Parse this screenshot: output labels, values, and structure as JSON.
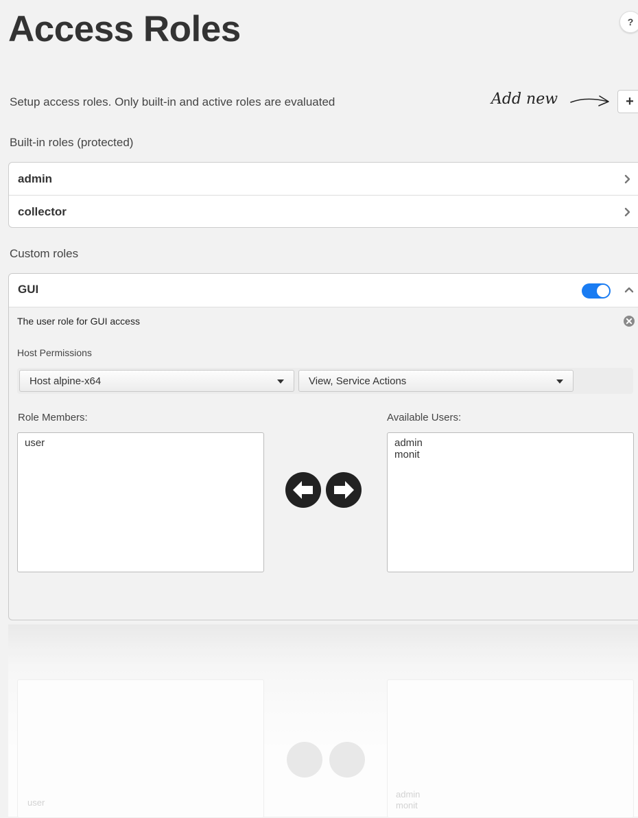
{
  "page": {
    "title": "Access Roles",
    "help_label": "?",
    "subtitle": "Setup access roles. Only built-in and active roles are evaluated",
    "add_new_hint": "Add new",
    "add_button_label": "+"
  },
  "builtin": {
    "label": "Built-in roles (protected)",
    "roles": [
      {
        "name": "admin"
      },
      {
        "name": "collector"
      }
    ]
  },
  "custom": {
    "label": "Custom roles",
    "role": {
      "name": "GUI",
      "active": true,
      "description": "The user role for GUI access",
      "host_permissions_label": "Host Permissions",
      "host_select": "Host alpine-x64",
      "permission_select": "View, Service Actions",
      "role_members_label": "Role Members:",
      "role_members": [
        "user"
      ],
      "available_users_label": "Available Users:",
      "available_users": [
        "admin",
        "monit"
      ]
    }
  },
  "ghost": {
    "left_text": "user",
    "right_text_1": "admin",
    "right_text_2": "monit"
  },
  "colors": {
    "toggle_on": "#1a7cf2",
    "circle_button": "#222222",
    "background": "#f2f2f2"
  },
  "icons": {
    "help": "question-mark-icon",
    "add": "plus-icon",
    "row_expand": "chevron-right-icon",
    "collapse": "chevron-up-icon",
    "remove": "circle-x-icon",
    "move_left": "circle-arrow-left-icon",
    "move_right": "circle-arrow-right-icon"
  }
}
